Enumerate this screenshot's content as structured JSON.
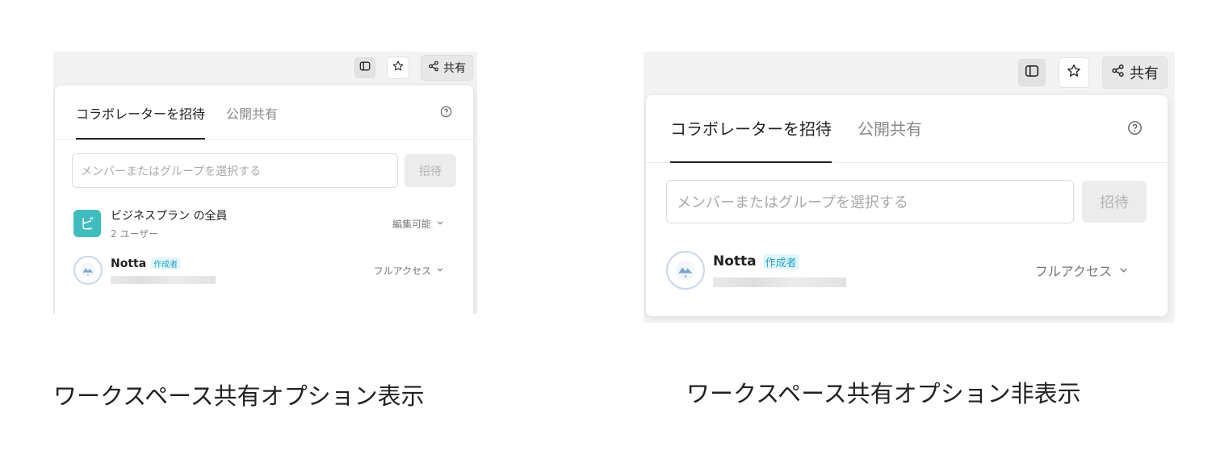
{
  "left": {
    "toolbar": {
      "share_label": "共有"
    },
    "tabs": [
      {
        "label": "コラボレーターを招待"
      },
      {
        "label": "公開共有"
      }
    ],
    "invite": {
      "placeholder": "メンバーまたはグループを選択する",
      "button": "招待"
    },
    "members": [
      {
        "avatar_text": "ビ",
        "name": "ビジネスプラン の全員",
        "sub": "2 ユーザー",
        "permission": "編集可能"
      },
      {
        "name": "Notta",
        "badge": "作成者",
        "permission": "フルアクセス"
      }
    ],
    "caption": "ワークスペース共有オプション表示"
  },
  "right": {
    "toolbar": {
      "share_label": "共有"
    },
    "tabs": [
      {
        "label": "コラボレーターを招待"
      },
      {
        "label": "公開共有"
      }
    ],
    "invite": {
      "placeholder": "メンバーまたはグループを選択する",
      "button": "招待"
    },
    "members": [
      {
        "name": "Notta",
        "badge": "作成者",
        "permission": "フルアクセス"
      }
    ],
    "caption": "ワークスペース共有オプション非表示"
  },
  "icons": [
    "sidebar-icon",
    "star-icon",
    "share-icon",
    "help-icon",
    "chevron-down-icon",
    "avatar-icon"
  ],
  "colors": {
    "accent_teal": "#3fbdbe",
    "badge_blue": "#20a5c7",
    "active_tab": "#222222"
  }
}
